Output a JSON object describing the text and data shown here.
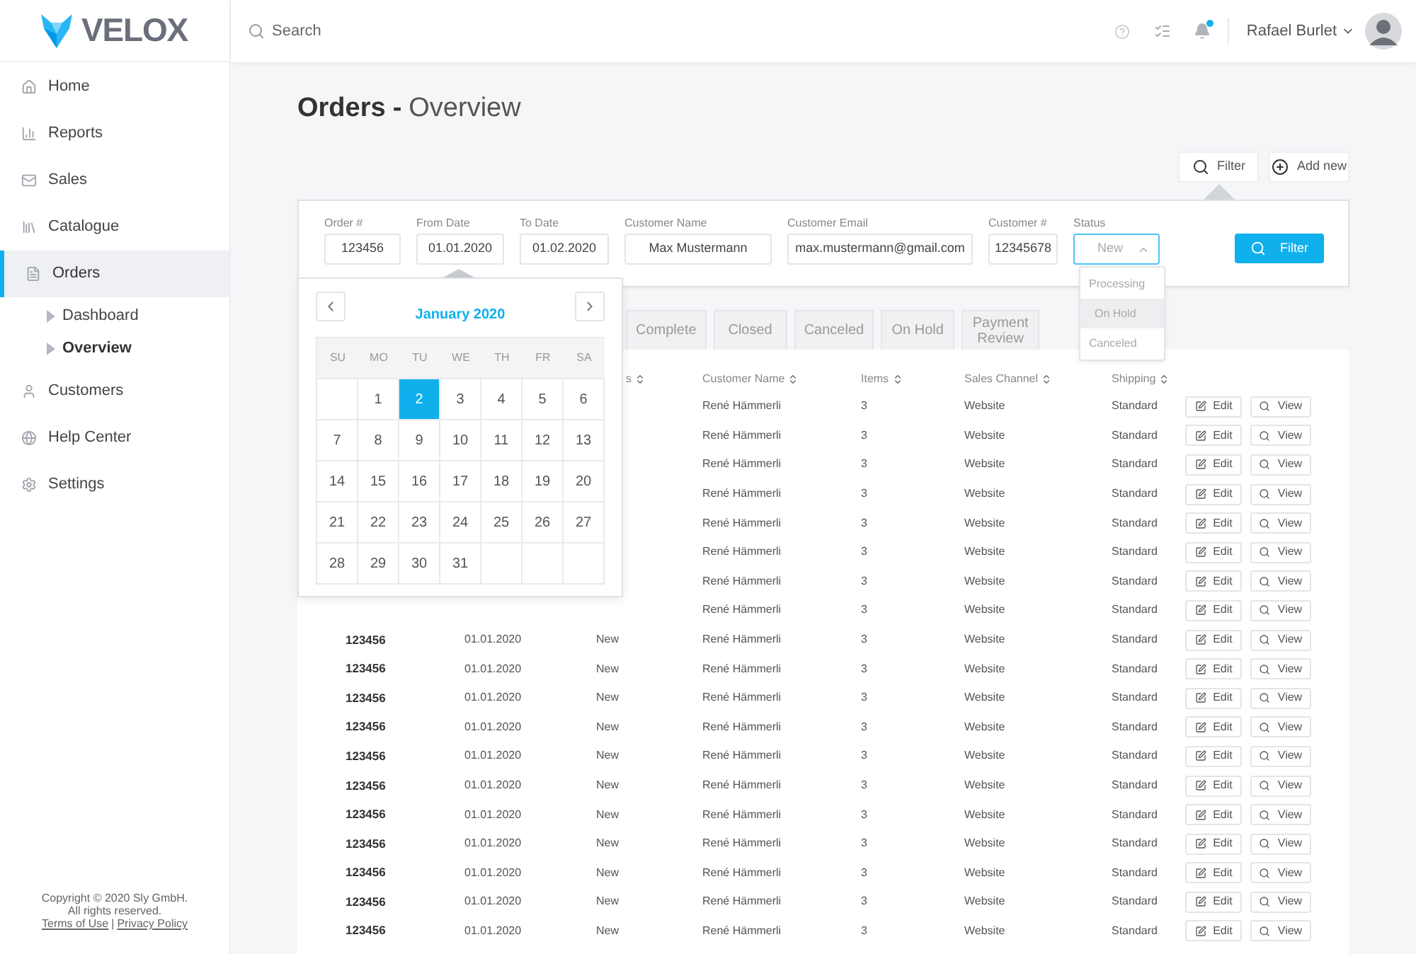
{
  "brand": {
    "name": "VELOX"
  },
  "search": {
    "placeholder": "Search"
  },
  "header": {
    "notifications_unread": true,
    "user": "Rafael Burlet"
  },
  "sidebar": {
    "items": [
      {
        "label": "Home",
        "selected": false
      },
      {
        "label": "Reports",
        "selected": false
      },
      {
        "label": "Sales",
        "selected": false
      },
      {
        "label": "Catalogue",
        "selected": false
      },
      {
        "label": "Orders",
        "selected": true,
        "expanded": true,
        "children": [
          {
            "label": "Dashboard",
            "selected": false
          },
          {
            "label": "Overview",
            "selected": true
          }
        ]
      },
      {
        "label": "Customers",
        "selected": false
      },
      {
        "label": "Help Center",
        "selected": false
      },
      {
        "label": "Settings",
        "selected": false
      }
    ],
    "footer": {
      "copyright": "Copyright © 2020 Sly GmbH.",
      "rights": "All rights reserved.",
      "links": [
        "Terms of Use",
        "Privacy Policy"
      ],
      "separator": "|"
    }
  },
  "page": {
    "title": "Orders",
    "separator": "-",
    "subtitle": "Overview"
  },
  "toolbar": {
    "buttons": [
      {
        "label": "Filter",
        "kind": "filter"
      },
      {
        "label": "Add new",
        "kind": "add"
      }
    ]
  },
  "filters": {
    "fields": [
      {
        "label": "Order #",
        "value": "123456",
        "kind": "text"
      },
      {
        "label": "From Date",
        "value": "01.01.2020",
        "kind": "date",
        "expanded": true
      },
      {
        "label": "To Date",
        "value": "01.02.2020",
        "kind": "date"
      },
      {
        "label": "Customer Name",
        "value": "Max Mustermann",
        "kind": "text"
      },
      {
        "label": "Customer Email",
        "value": "max.mustermann@gmail.com",
        "kind": "text"
      },
      {
        "label": "Customer #",
        "value": "12345678",
        "kind": "text"
      },
      {
        "label": "Status",
        "value": "New",
        "kind": "select",
        "expanded": true,
        "options": [
          {
            "label": "Processing",
            "selected": false
          },
          {
            "label": "On Hold",
            "selected": true
          },
          {
            "label": "Canceled",
            "selected": false
          }
        ]
      }
    ],
    "button": "Filter"
  },
  "date_picker": {
    "title": "January 2020",
    "weekdays": [
      "SU",
      "MO",
      "TU",
      "WE",
      "TH",
      "FR",
      "SA"
    ],
    "days": [
      {
        "label": "1",
        "selected": false
      },
      {
        "label": "2",
        "selected": true
      },
      {
        "label": "3",
        "selected": false
      },
      {
        "label": "4",
        "selected": false
      },
      {
        "label": "5",
        "selected": false
      },
      {
        "label": "6",
        "selected": false
      },
      {
        "label": "7",
        "selected": false
      },
      {
        "label": "8",
        "selected": false
      },
      {
        "label": "9",
        "selected": false
      },
      {
        "label": "10",
        "selected": false
      },
      {
        "label": "11",
        "selected": false
      },
      {
        "label": "12",
        "selected": false
      },
      {
        "label": "13",
        "selected": false
      },
      {
        "label": "14",
        "selected": false
      },
      {
        "label": "15",
        "selected": false
      },
      {
        "label": "16",
        "selected": false
      },
      {
        "label": "17",
        "selected": false
      },
      {
        "label": "18",
        "selected": false
      },
      {
        "label": "19",
        "selected": false
      },
      {
        "label": "20",
        "selected": false
      },
      {
        "label": "21",
        "selected": false
      },
      {
        "label": "22",
        "selected": false
      },
      {
        "label": "23",
        "selected": false
      },
      {
        "label": "24",
        "selected": false
      },
      {
        "label": "25",
        "selected": false
      },
      {
        "label": "26",
        "selected": false
      },
      {
        "label": "27",
        "selected": false
      },
      {
        "label": "28",
        "selected": false
      },
      {
        "label": "29",
        "selected": false
      },
      {
        "label": "30",
        "selected": false
      },
      {
        "label": "31",
        "selected": false
      }
    ]
  },
  "tabs": [
    {
      "label": "Complete",
      "selected": false
    },
    {
      "label": "Closed",
      "selected": false
    },
    {
      "label": "Canceled",
      "selected": false
    },
    {
      "label": "On Hold",
      "selected": false
    },
    {
      "label": "Payment Review",
      "selected": false
    }
  ],
  "table": {
    "columns": [
      {
        "label": "s"
      },
      {
        "label": "Customer Name"
      },
      {
        "label": "Items"
      },
      {
        "label": "Sales Channel"
      },
      {
        "label": "Shipping"
      }
    ],
    "rows": [
      {
        "customer": "René Hämmerli",
        "items": "3",
        "channel": "Website",
        "shipping": "Standard",
        "edit": "Edit",
        "view": "View"
      },
      {
        "customer": "René Hämmerli",
        "items": "3",
        "channel": "Website",
        "shipping": "Standard",
        "edit": "Edit",
        "view": "View"
      },
      {
        "customer": "René Hämmerli",
        "items": "3",
        "channel": "Website",
        "shipping": "Standard",
        "edit": "Edit",
        "view": "View"
      },
      {
        "customer": "René Hämmerli",
        "items": "3",
        "channel": "Website",
        "shipping": "Standard",
        "edit": "Edit",
        "view": "View"
      },
      {
        "customer": "René Hämmerli",
        "items": "3",
        "channel": "Website",
        "shipping": "Standard",
        "edit": "Edit",
        "view": "View"
      },
      {
        "customer": "René Hämmerli",
        "items": "3",
        "channel": "Website",
        "shipping": "Standard",
        "edit": "Edit",
        "view": "View"
      },
      {
        "customer": "René Hämmerli",
        "items": "3",
        "channel": "Website",
        "shipping": "Standard",
        "edit": "Edit",
        "view": "View"
      },
      {
        "customer": "René Hämmerli",
        "items": "3",
        "channel": "Website",
        "shipping": "Standard",
        "edit": "Edit",
        "view": "View"
      },
      {
        "order": "123456",
        "date": "01.01.2020",
        "status": "New",
        "customer": "René Hämmerli",
        "items": "3",
        "channel": "Website",
        "shipping": "Standard",
        "edit": "Edit",
        "view": "View"
      },
      {
        "order": "123456",
        "date": "01.01.2020",
        "status": "New",
        "customer": "René Hämmerli",
        "items": "3",
        "channel": "Website",
        "shipping": "Standard",
        "edit": "Edit",
        "view": "View"
      },
      {
        "order": "123456",
        "date": "01.01.2020",
        "status": "New",
        "customer": "René Hämmerli",
        "items": "3",
        "channel": "Website",
        "shipping": "Standard",
        "edit": "Edit",
        "view": "View"
      },
      {
        "order": "123456",
        "date": "01.01.2020",
        "status": "New",
        "customer": "René Hämmerli",
        "items": "3",
        "channel": "Website",
        "shipping": "Standard",
        "edit": "Edit",
        "view": "View"
      },
      {
        "order": "123456",
        "date": "01.01.2020",
        "status": "New",
        "customer": "René Hämmerli",
        "items": "3",
        "channel": "Website",
        "shipping": "Standard",
        "edit": "Edit",
        "view": "View"
      },
      {
        "order": "123456",
        "date": "01.01.2020",
        "status": "New",
        "customer": "René Hämmerli",
        "items": "3",
        "channel": "Website",
        "shipping": "Standard",
        "edit": "Edit",
        "view": "View"
      },
      {
        "order": "123456",
        "date": "01.01.2020",
        "status": "New",
        "customer": "René Hämmerli",
        "items": "3",
        "channel": "Website",
        "shipping": "Standard",
        "edit": "Edit",
        "view": "View"
      },
      {
        "order": "123456",
        "date": "01.01.2020",
        "status": "New",
        "customer": "René Hämmerli",
        "items": "3",
        "channel": "Website",
        "shipping": "Standard",
        "edit": "Edit",
        "view": "View"
      },
      {
        "order": "123456",
        "date": "01.01.2020",
        "status": "New",
        "customer": "René Hämmerli",
        "items": "3",
        "channel": "Website",
        "shipping": "Standard",
        "edit": "Edit",
        "view": "View"
      },
      {
        "order": "123456",
        "date": "01.01.2020",
        "status": "New",
        "customer": "René Hämmerli",
        "items": "3",
        "channel": "Website",
        "shipping": "Standard",
        "edit": "Edit",
        "view": "View"
      },
      {
        "order": "123456",
        "date": "01.01.2020",
        "status": "New",
        "customer": "René Hämmerli",
        "items": "3",
        "channel": "Website",
        "shipping": "Standard",
        "edit": "Edit",
        "view": "View"
      }
    ]
  }
}
